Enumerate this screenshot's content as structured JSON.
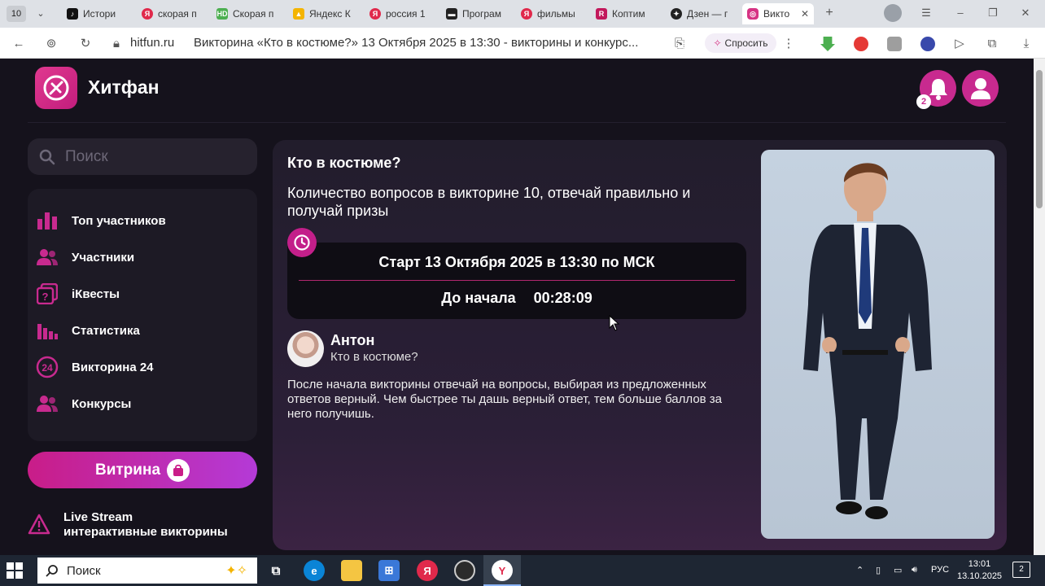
{
  "browser": {
    "tab_count": "10",
    "tabs": [
      {
        "label": "Истори",
        "fav": "tiktok",
        "color": "#111111"
      },
      {
        "label": "скорая п",
        "fav": "yandex",
        "color": "#e0294b"
      },
      {
        "label": "Скорая п",
        "fav": "hd",
        "color": "#4caf50"
      },
      {
        "label": "Яндекс К",
        "fav": "mountain",
        "color": "#f4b400"
      },
      {
        "label": "россия 1",
        "fav": "yandex",
        "color": "#e0294b"
      },
      {
        "label": "Програм",
        "fav": "tv",
        "color": "#222222"
      },
      {
        "label": "фильмы",
        "fav": "yandex",
        "color": "#e0294b"
      },
      {
        "label": "Коптим",
        "fav": "r",
        "color": "#c2185b"
      },
      {
        "label": "Дзен — г",
        "fav": "dzen",
        "color": "#222222"
      },
      {
        "label": "Викто",
        "fav": "hitfun",
        "color": "#d63384"
      }
    ],
    "domain": "hitfun.ru",
    "page_title": "Викторина «Кто в костюме?» 13 Октября 2025 в 13:30 - викторины и конкурс...",
    "ask_label": "Спросить"
  },
  "site": {
    "brand": "Хитфан",
    "notifications": "2",
    "search_placeholder": "Поиск",
    "menu": [
      {
        "label": "Топ участников",
        "icon": "bar-chart-icon"
      },
      {
        "label": "Участники",
        "icon": "users-icon"
      },
      {
        "label": "iКвесты",
        "icon": "quest-icon"
      },
      {
        "label": "Статистика",
        "icon": "stats-icon"
      },
      {
        "label": "Викторина 24",
        "icon": "quiz-24-icon"
      },
      {
        "label": "Конкурсы",
        "icon": "contests-icon"
      }
    ],
    "vitrina": "Витрина",
    "live_title": "Live Stream",
    "live_sub": "интерактивные викторины"
  },
  "quiz": {
    "title": "Кто в костюме?",
    "description": "Количество вопросов в викторине 10, отвечай правильно и получай призы",
    "start": "Старт 13 Октября 2025 в 13:30 по МСК",
    "countdown_label": "До начала",
    "countdown": "00:28:09",
    "host_name": "Антон",
    "host_sub": "Кто в костюме?",
    "rules": "После начала викторины отвечай на вопросы, выбирая из предложенных ответов верный. Чем быстрее ты дашь верный ответ, тем больше баллов за него получишь."
  },
  "taskbar": {
    "search": "Поиск",
    "lang": "РУС",
    "time": "13:01",
    "date": "13.10.2025",
    "notif_count": "2"
  },
  "colors": {
    "accent": "#c82a8f",
    "page_bg": "#15121c",
    "card_bg": "#221d2c"
  }
}
